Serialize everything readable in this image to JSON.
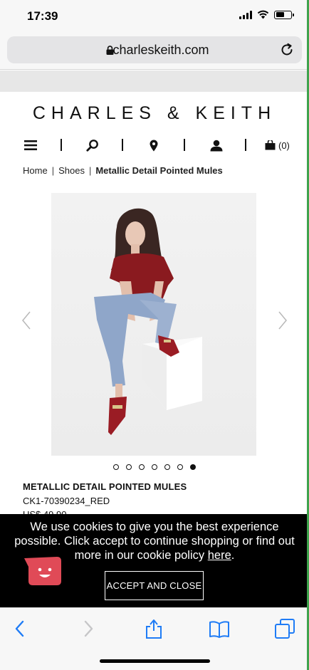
{
  "status_bar": {
    "time": "17:39"
  },
  "browser": {
    "url": "charleskeith.com"
  },
  "site": {
    "brand": "CHARLES & KEITH",
    "cart_count": "(0)"
  },
  "breadcrumb": {
    "items": [
      "Home",
      "Shoes",
      "Metallic Detail Pointed Mules"
    ]
  },
  "product": {
    "title": "METALLIC DETAIL POINTED MULES",
    "sku": "CK1-70390234_RED",
    "price": "US$ 49.90",
    "image_count": 7,
    "active_image_index": 7
  },
  "cookie": {
    "text_before": "We use cookies to give you the best experience possible. Click accept to continue shopping or find out more in our cookie policy ",
    "link": "here",
    "text_after": ".",
    "accept_label": "ACCEPT AND CLOSE"
  },
  "icons": {
    "menu": "hamburger-icon",
    "search": "search-icon",
    "store": "location-pin-icon",
    "account": "user-icon",
    "bag": "shopping-bag-icon",
    "back": "back-chevron-icon",
    "forward": "forward-chevron-icon",
    "share": "share-icon",
    "bookmarks": "book-icon",
    "tabs": "tabs-icon"
  },
  "colors": {
    "ios_blue": "#1f7cf6",
    "cookie_bg": "#000000",
    "chat_red": "#e04a57",
    "shirt_red": "#8a1a1f",
    "denim": "#8fa6c9"
  }
}
